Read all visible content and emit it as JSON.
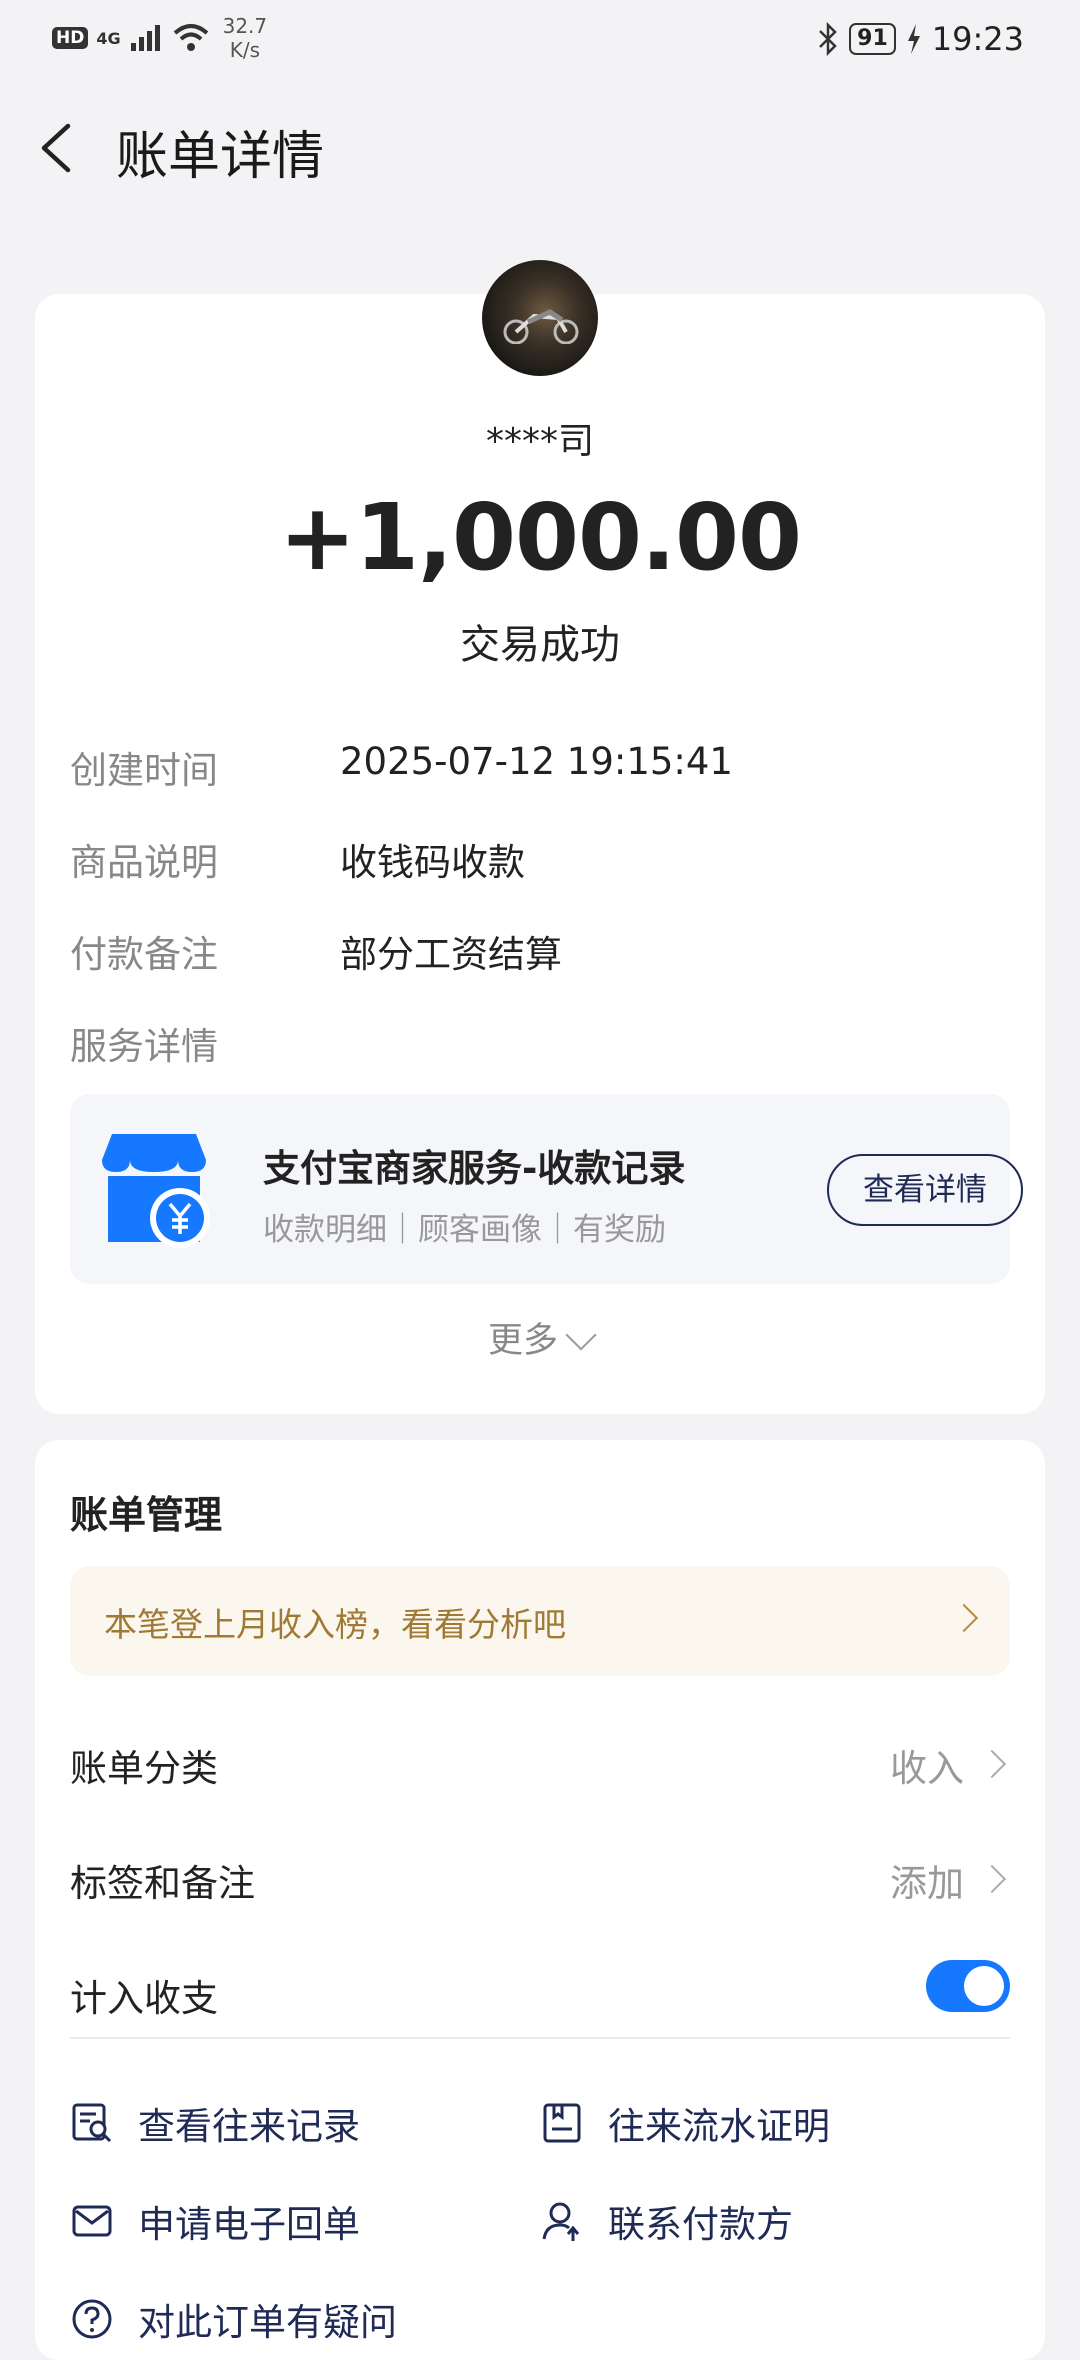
{
  "status_bar": {
    "hd": "HD",
    "network": "4G",
    "speed_value": "32.7",
    "speed_unit": "K/s",
    "battery": "91",
    "time": "19:23"
  },
  "header": {
    "title": "账单详情"
  },
  "transaction": {
    "payee": "****司",
    "amount": "+1,000.00",
    "status": "交易成功",
    "details": [
      {
        "label": "创建时间",
        "value": "2025-07-12 19:15:41"
      },
      {
        "label": "商品说明",
        "value": "收钱码收款"
      },
      {
        "label": "付款备注",
        "value": "部分工资结算"
      },
      {
        "label": "服务详情",
        "value": ""
      }
    ]
  },
  "service": {
    "title": "支付宝商家服务-收款记录",
    "subtitle": "收款明细｜顾客画像｜有奖励",
    "button": "查看详情",
    "icon": "store-yuan-icon"
  },
  "more_label": "更多",
  "management": {
    "title": "账单管理",
    "banner": "本笔登上月收入榜，看看分析吧",
    "items": [
      {
        "name": "账单分类",
        "value": "收入"
      },
      {
        "name": "标签和备注",
        "value": "添加"
      },
      {
        "name": "计入收支",
        "toggle": true
      }
    ],
    "actions": [
      {
        "label": "查看往来记录",
        "icon": "record-search-icon"
      },
      {
        "label": "往来流水证明",
        "icon": "statement-icon"
      },
      {
        "label": "申请电子回单",
        "icon": "mail-icon"
      },
      {
        "label": "联系付款方",
        "icon": "contact-user-icon"
      },
      {
        "label": "对此订单有疑问",
        "icon": "question-icon"
      }
    ]
  },
  "colors": {
    "accent": "#1677ff",
    "navy_text": "#1f2a55",
    "banner_text": "#a07a35",
    "background": "#f3f3f5"
  }
}
